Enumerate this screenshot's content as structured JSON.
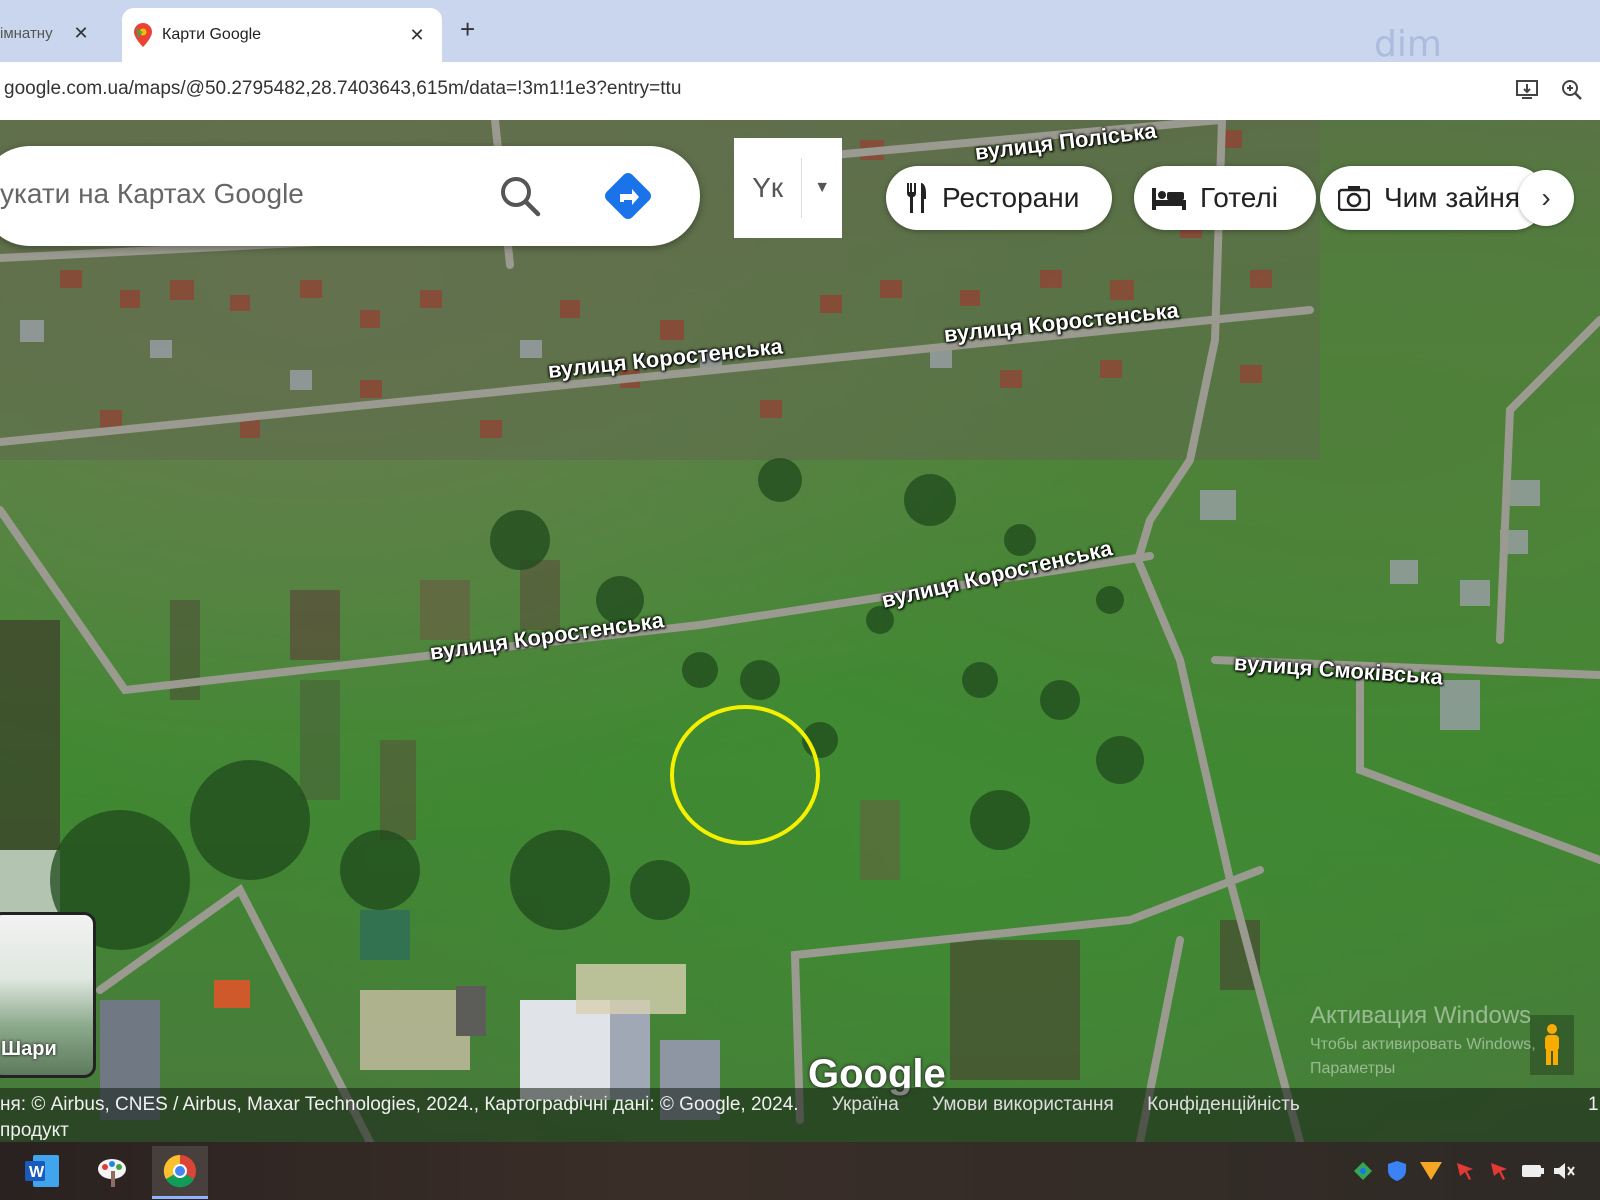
{
  "browser": {
    "tabs": [
      {
        "title": "імнатну",
        "active": false
      },
      {
        "title": "Карти Google",
        "active": true
      }
    ],
    "new_tab_label": "+",
    "close_glyph": "✕",
    "url": "google.com.ua/maps/@50.2795482,28.7403643,615m/data=!3m1!1e3?entry=ttu",
    "watermark": "dim"
  },
  "search": {
    "placeholder": "укати на Картах Google"
  },
  "ime": {
    "lang": "Yк"
  },
  "chips": [
    {
      "label": "Ресторани",
      "icon": "fork-knife-icon"
    },
    {
      "label": "Готелі",
      "icon": "bed-icon"
    },
    {
      "label": "Чим зайнятися",
      "icon": "camera-icon"
    }
  ],
  "streets": {
    "poliska": "вулиця Поліська",
    "korostenska_1": "вулиця Коростенська",
    "korostenska_2": "вулиця Коростенська",
    "korostenska_3": "вулиця Коростенська",
    "korostenska_4": "вулиця Коростенська",
    "smokivska": "вулиця Смоківська"
  },
  "layers_thumb": {
    "label": "Шари"
  },
  "google_logo": "Google",
  "windows_activation": {
    "line1": "Активация Windows",
    "line2": "Чтобы активировать Windows,",
    "line3": "Параметры"
  },
  "attribution": {
    "imagery": "ня: © Airbus, CNES / Airbus, Maxar Technologies, 2024., Картографічні дані: © Google, 2024.",
    "links": [
      "Україна",
      "Умови використання",
      "Конфіденційність"
    ],
    "scale_prefix": "1",
    "row2": "продукт"
  },
  "taskbar": {
    "apps": [
      "word-icon",
      "paint-icon",
      "chrome-icon"
    ],
    "tray": [
      "network-icon",
      "shield-icon",
      "wifi-icon",
      "flag-icon",
      "flag-icon",
      "battery-icon",
      "volume-mute-icon"
    ]
  },
  "colors": {
    "highlight_circle": "#f5f000",
    "directions_blue": "#1a73e8"
  }
}
